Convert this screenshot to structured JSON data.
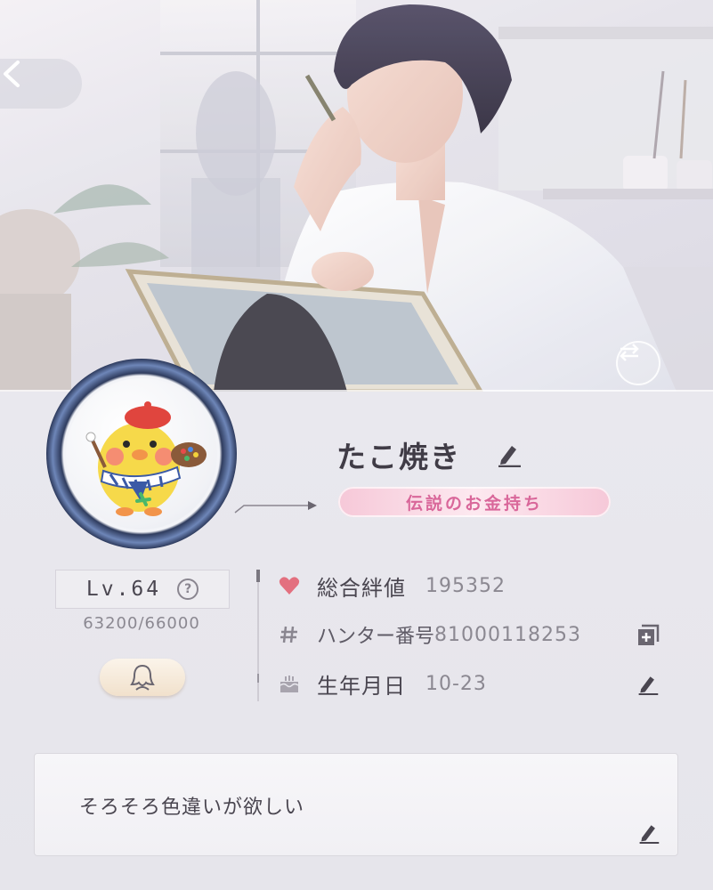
{
  "banner": {
    "back_icon": "chevron-left-icon",
    "swap_icon": "swap-arrows-icon"
  },
  "profile": {
    "nickname": "たこ焼き",
    "title_badge": "伝説のお金持ち",
    "level_label": "Lv.64",
    "level_help": "?",
    "exp": "63200/66000"
  },
  "stats": {
    "bond_label": "総合絆値",
    "bond_value": "195352",
    "hunter_label": "ハンター番号",
    "hunter_value": "81000118253",
    "birthday_label": "生年月日",
    "birthday_value": "10-23"
  },
  "bio": {
    "text": "そろそろ色違いが欲しい"
  },
  "colors": {
    "heart": "#e3707f",
    "badge_text": "#d9679a",
    "icon_gray": "#8a8690"
  }
}
